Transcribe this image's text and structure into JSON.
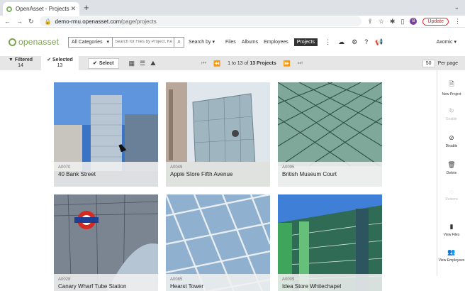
{
  "browser": {
    "tab_title": "OpenAsset - Projects",
    "url_domain": "demo-rmu.openasset.com",
    "url_path": "/page/projects",
    "update_label": "Update",
    "avatar_initial": "B"
  },
  "header": {
    "logo_text": "openasset",
    "category_value": "All Categories",
    "search_placeholder": "Search for Files by Project, Ke",
    "search_by_label": "Search by",
    "nav": [
      "Files",
      "Albums",
      "Employees",
      "Projects"
    ],
    "active_nav": "Projects",
    "account": "Axomic"
  },
  "toolbar": {
    "filtered_label": "Filtered",
    "filtered_count": "14",
    "selected_label": "Selected",
    "selected_count": "13",
    "select_button": "Select",
    "pager_text": "1 to 13 of",
    "pager_total": "13 Projects",
    "per_page_value": "50",
    "per_page_label": "Per page"
  },
  "projects": [
    {
      "code": "A0070",
      "name": "40 Bank Street"
    },
    {
      "code": "A0049",
      "name": "Apple Store Fifth Avenue"
    },
    {
      "code": "A0095",
      "name": "British Museum Court"
    },
    {
      "code": "A0028",
      "name": "Canary Wharf Tube Station"
    },
    {
      "code": "A0085",
      "name": "Hearst Tower"
    },
    {
      "code": "A0009",
      "name": "Idea Store Whitechapel"
    }
  ],
  "rail_actions": [
    {
      "label": "New Project",
      "icon": "document-plus-icon",
      "enabled": true
    },
    {
      "label": "Enable",
      "icon": "refresh-icon",
      "enabled": false
    },
    {
      "label": "Disable",
      "icon": "ban-icon",
      "enabled": true
    },
    {
      "label": "Delete",
      "icon": "trash-icon",
      "enabled": true
    },
    {
      "label": "Restore",
      "icon": "restore-icon",
      "enabled": false
    },
    {
      "label": "View Files",
      "icon": "file-icon",
      "enabled": true
    },
    {
      "label": "View Employees",
      "icon": "people-icon",
      "enabled": true
    }
  ],
  "colors": {
    "brand_green": "#7aa54a",
    "toolbar_bg": "#e6e6e6",
    "active_nav_bg": "#333333"
  }
}
